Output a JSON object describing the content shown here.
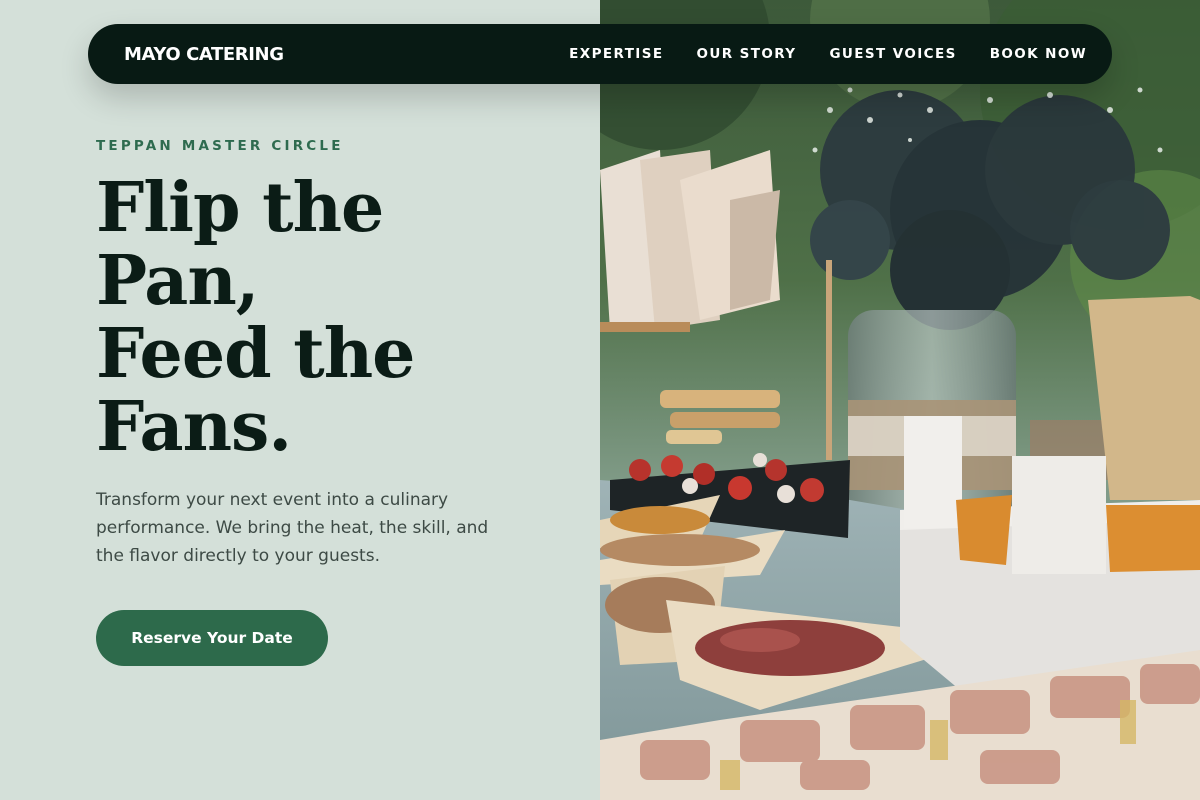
{
  "nav": {
    "brand": "MAYO CATERING",
    "links": [
      "EXPERTISE",
      "OUR STORY",
      "GUEST VOICES",
      "BOOK NOW"
    ]
  },
  "hero": {
    "eyebrow": "TEPPAN MASTER CIRCLE",
    "title_lines": [
      "Flip the",
      "Pan,",
      "Feed the",
      "Fans."
    ],
    "description": "Transform your next event into a culinary performance. We bring the heat, the skill, and the flavor directly to your guests.",
    "cta_label": "Reserve Your Date"
  },
  "photo": {
    "subject": "outdoor catering buffet table with snacks, sandwiches and a floral centerpiece"
  },
  "colors": {
    "background": "#d4e0d9",
    "nav_bg": "#081a14",
    "accent_green": "#2d6a4b",
    "eyebrow_green": "#2e6b4f",
    "heading": "#0b1c16",
    "body_text": "#3d4a45"
  }
}
